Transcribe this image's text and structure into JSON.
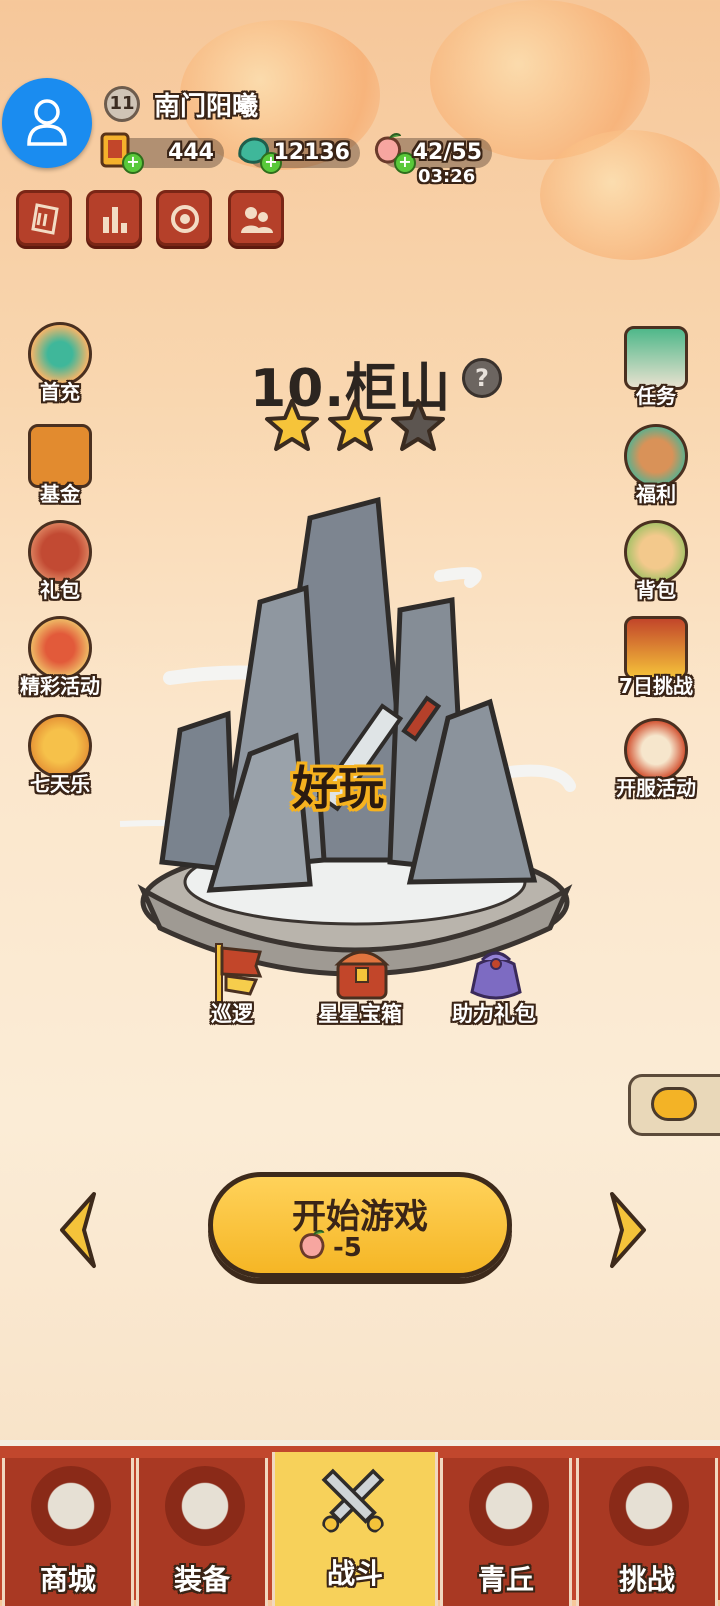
{
  "player": {
    "level": "11",
    "name": "南门阳曦"
  },
  "resources": {
    "scroll": {
      "value": "444",
      "icon": "scroll-icon"
    },
    "jade": {
      "value": "12136",
      "icon": "jade-dragon-icon"
    },
    "stamina": {
      "value": "42/55",
      "timer": "03:26",
      "icon": "peach-icon"
    }
  },
  "toolbar": [
    "ticket-icon",
    "ranking-icon",
    "settings-icon",
    "friends-icon"
  ],
  "left_menu": [
    {
      "label": "首充",
      "icon": "first-charge-icon"
    },
    {
      "label": "基金",
      "icon": "fund-icon"
    },
    {
      "label": "礼包",
      "icon": "gift-pack-icon"
    },
    {
      "label": "精彩活动",
      "icon": "activity-icon"
    },
    {
      "label": "七天乐",
      "icon": "seven-day-icon"
    }
  ],
  "right_menu": [
    {
      "label": "任务",
      "icon": "task-icon"
    },
    {
      "label": "福利",
      "icon": "welfare-icon"
    },
    {
      "label": "背包",
      "icon": "bag-icon"
    },
    {
      "label": "7日挑战",
      "icon": "seven-day-challenge-icon"
    },
    {
      "label": "开服活动",
      "icon": "server-event-icon"
    }
  ],
  "stage": {
    "title": "10.柜山",
    "stars_earned": 2,
    "stars_total": 3,
    "overlay_text": "好玩"
  },
  "rewards": [
    {
      "label": "巡逻",
      "icon": "patrol-flag-icon"
    },
    {
      "label": "星星宝箱",
      "icon": "star-chest-icon"
    },
    {
      "label": "助力礼包",
      "icon": "support-gift-icon"
    }
  ],
  "start": {
    "label": "开始游戏",
    "cost": "-5"
  },
  "nav": [
    {
      "label": "商城",
      "icon": "shop-icon",
      "active": false
    },
    {
      "label": "装备",
      "icon": "equipment-icon",
      "active": false
    },
    {
      "label": "战斗",
      "icon": "battle-icon",
      "active": true
    },
    {
      "label": "青丘",
      "icon": "qingqiu-icon",
      "active": false
    },
    {
      "label": "挑战",
      "icon": "challenge-icon",
      "active": false
    }
  ],
  "colors": {
    "accent": "#f5b625",
    "nav_bg": "#c1472d",
    "nav_active": "#f7d15a",
    "text_outline": "#3a2416"
  }
}
